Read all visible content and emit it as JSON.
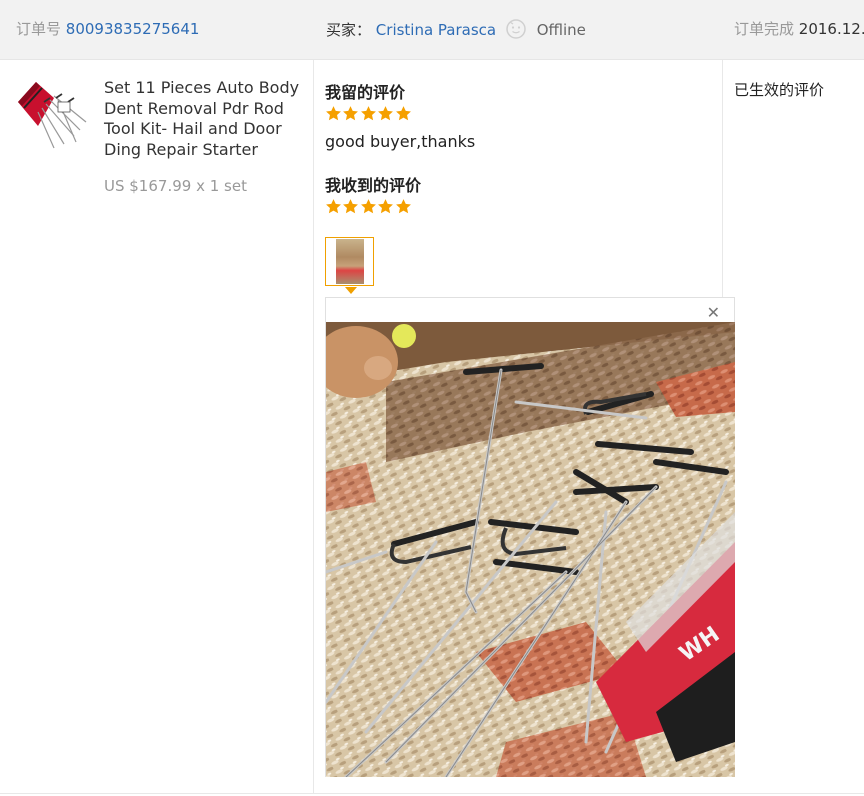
{
  "header": {
    "order_label": "订单号",
    "order_number": "80093835275641",
    "buyer_label": "买家：",
    "buyer_name": "Cristina Parasca",
    "buyer_status": "Offline",
    "completed_label": "订单完成",
    "completed_date": "2016.12."
  },
  "product": {
    "image_icon": "pdr-tool-kit-thumbnail",
    "title": "Set 11 Pieces Auto Body Dent Removal Pdr Rod Tool Kit- Hail and Door Ding Repair Starter",
    "price": "US $167.99 x 1 set"
  },
  "feedback": {
    "my_review_label": "我留的评价",
    "my_review_stars": 5,
    "my_review_comment": "good buyer,thanks",
    "received_review_label": "我收到的评价",
    "received_review_stars": 5,
    "star_color": "#f5a000"
  },
  "status": {
    "text": "已生效的评价"
  },
  "popup": {
    "close_icon": "close-icon",
    "photo_icon": "buyer-photo-pdr-rods-on-carpet"
  }
}
